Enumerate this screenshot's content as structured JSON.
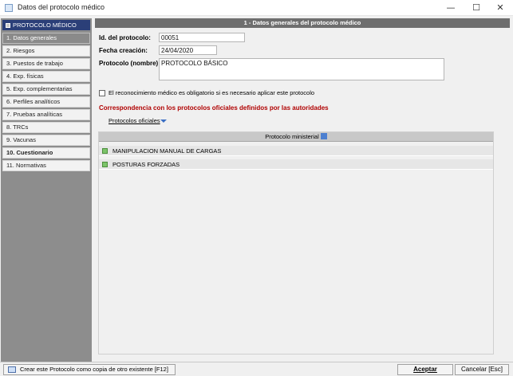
{
  "window": {
    "title": "Datos del protocolo médico",
    "minimize": "—",
    "maximize": "☐",
    "close": "✕"
  },
  "sidebar": {
    "header": "PROTOCOLO MÉDICO",
    "items": [
      {
        "label": "1. Datos generales"
      },
      {
        "label": "2. Riesgos"
      },
      {
        "label": "3. Puestos de trabajo"
      },
      {
        "label": "4. Exp. físicas"
      },
      {
        "label": "5. Exp. complementarias"
      },
      {
        "label": "6. Perfiles analíticos"
      },
      {
        "label": "7. Pruebas analíticas"
      },
      {
        "label": "8. TRCs"
      },
      {
        "label": "9. Vacunas"
      },
      {
        "label": "10. Cuestionario"
      },
      {
        "label": "11. Normativas"
      }
    ]
  },
  "main": {
    "header": "1 - Datos generales del protocolo médico",
    "id_label": "Id. del protocolo:",
    "id_value": "00051",
    "fecha_label": "Fecha creación:",
    "fecha_value": "24/04/2020",
    "nombre_label": "Protocolo (nombre):",
    "nombre_value": "PROTOCOLO BÁSICO",
    "checkbox_label": "El reconocimiento médico es obligatorio si es necesario aplicar este protocolo",
    "correspondencia_title": "Correspondencia con los protocolos oficiales definidos por las autoridades",
    "protocolos_oficiales": "Protocolos oficiales",
    "grid": {
      "column_header": "Protocolo ministerial",
      "rows": [
        {
          "label": "MANIPULACION MANUAL DE CARGAS"
        },
        {
          "label": "POSTURAS FORZADAS"
        }
      ]
    }
  },
  "footer": {
    "copy_button": "Crear este Protocolo como copia de otro existente  [F12]",
    "accept_button": "Aceptar",
    "cancel_button": "Cancelar  [Esc]"
  },
  "colors": {
    "sidebar_header_bg": "#2b3f78",
    "main_header_bg": "#6e6e6e",
    "accent_red": "#b00000"
  }
}
